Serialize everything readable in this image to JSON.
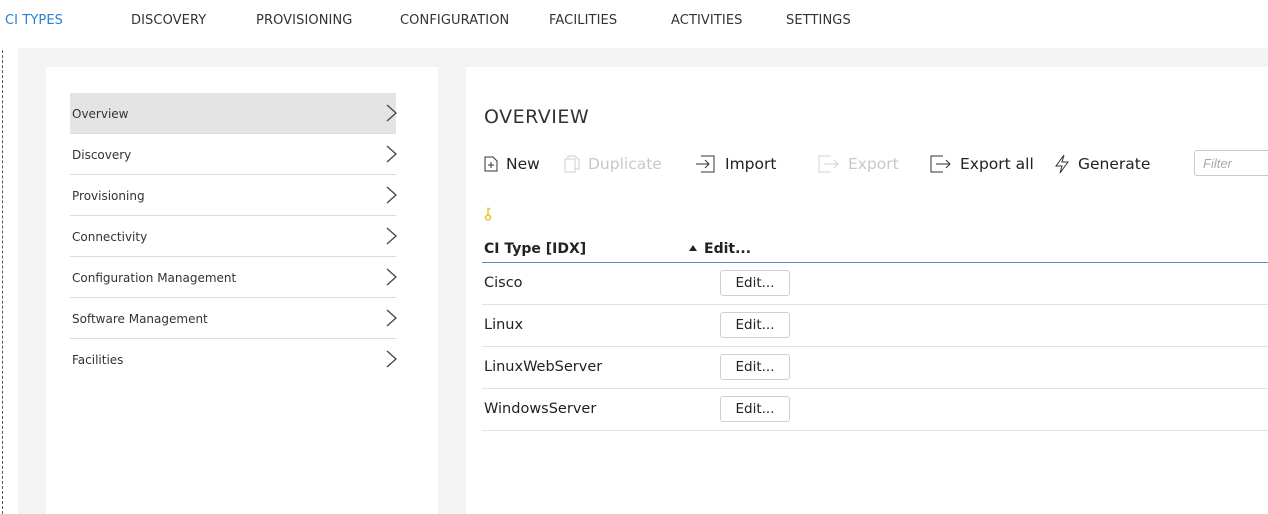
{
  "nav": {
    "tabs": [
      {
        "label": "CI TYPES",
        "active": true
      },
      {
        "label": "DISCOVERY"
      },
      {
        "label": "PROVISIONING"
      },
      {
        "label": "CONFIGURATION"
      },
      {
        "label": "FACILITIES"
      },
      {
        "label": "ACTIVITIES"
      },
      {
        "label": "SETTINGS"
      }
    ],
    "accent_color": "#2a7fd4"
  },
  "sidebar": {
    "items": [
      {
        "label": "Overview",
        "active": true
      },
      {
        "label": "Discovery"
      },
      {
        "label": "Provisioning"
      },
      {
        "label": "Connectivity"
      },
      {
        "label": "Configuration Management"
      },
      {
        "label": "Software Management"
      },
      {
        "label": "Facilities"
      }
    ]
  },
  "main": {
    "title": "OVERVIEW",
    "toolbar": {
      "new": "New",
      "duplicate": "Duplicate",
      "import": "Import",
      "export": "Export",
      "export_all": "Export all",
      "generate": "Generate",
      "filter_placeholder": "Filter"
    },
    "grid": {
      "col_type": "CI Type [IDX]",
      "col_edit": "Edit...",
      "sort": "ascending",
      "rows": [
        {
          "name": "Cisco",
          "action": "Edit..."
        },
        {
          "name": "Linux",
          "action": "Edit..."
        },
        {
          "name": "LinuxWebServer",
          "action": "Edit..."
        },
        {
          "name": "WindowsServer",
          "action": "Edit..."
        }
      ]
    },
    "key_icon_color": "#e6c229"
  }
}
